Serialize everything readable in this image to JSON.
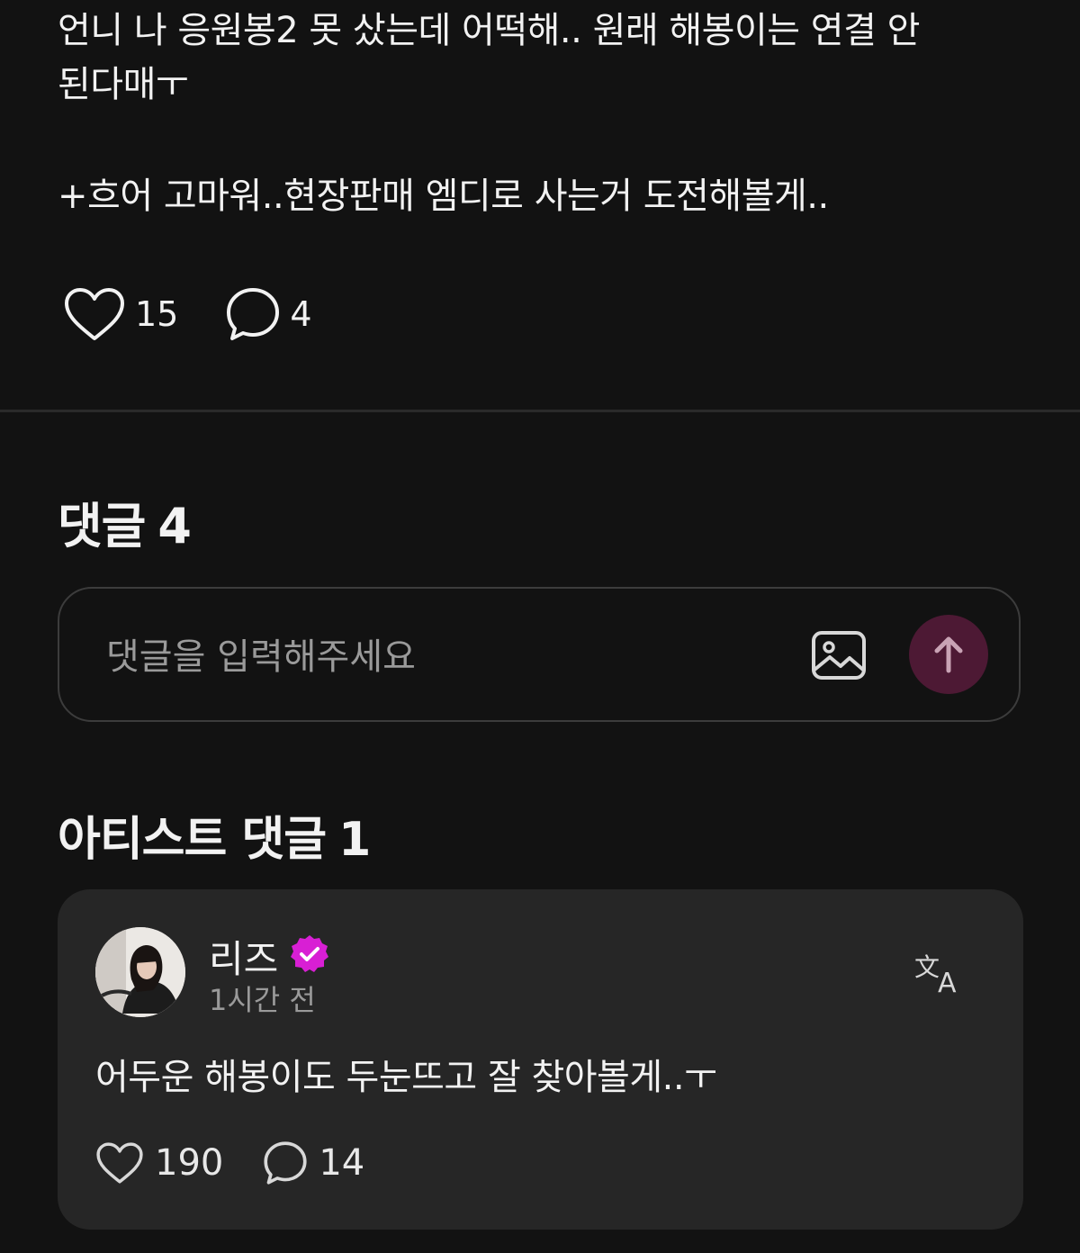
{
  "post": {
    "line1": "언니 나 응원봉2 못 샀는데 어떡해.. 원래 해봉이는 연결 안",
    "line2": "된다매ㅜ",
    "line3": "+흐어 고마워..현장판매 엠디로 사는거 도전해볼게..",
    "like_count": "15",
    "comment_count": "4",
    "icons": {
      "like": "heart-icon",
      "comment": "speech-bubble-icon"
    }
  },
  "comments": {
    "title_label": "댓글",
    "title_count": "4",
    "input": {
      "placeholder": "댓글을 입력해주세요",
      "value": "",
      "image_icon": "image-icon",
      "send_icon": "arrow-up-icon"
    }
  },
  "artist_comments": {
    "title_label": "아티스트 댓글",
    "title_count": "1",
    "items": [
      {
        "author": "리즈",
        "verified": true,
        "time": "1시간 전",
        "text": "어두운 해봉이도 두눈뜨고 잘 찾아볼게..ㅜ",
        "like_count": "190",
        "reply_count": "14",
        "translate_icon": "translate-icon"
      }
    ]
  },
  "colors": {
    "background": "#121212",
    "card": "#262626",
    "send_button": "#4d1934",
    "verified_badge": "#d81fd4",
    "muted_text": "#9a9a9a"
  }
}
